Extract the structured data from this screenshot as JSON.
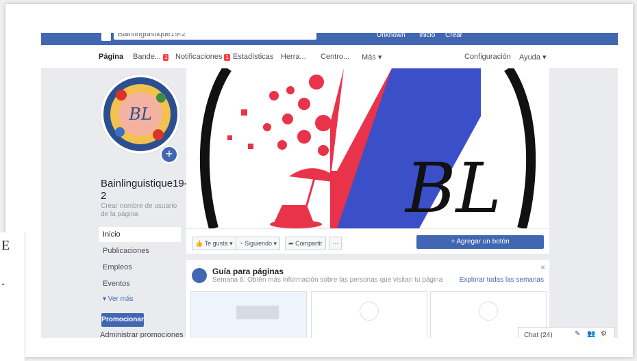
{
  "left_overlay": {
    "chars": [
      "E",
      "."
    ]
  },
  "topbar": {
    "search_value": "Bainlinguistique19-2",
    "user_name": "Unknown",
    "inicio": "Inicio",
    "crear": "Crear"
  },
  "pagenav": {
    "pagina": "Página",
    "bandeja": "Bande...",
    "bandeja_count": "1",
    "notificaciones": "Notificaciones",
    "notificaciones_count": "1",
    "estadisticas": "Estadísticas",
    "herramientas": "Herra...",
    "centro": "Centro...",
    "mas": "Más ▾",
    "configuracion": "Configuración",
    "ayuda": "Ayuda ▾"
  },
  "profile": {
    "avatar_text": "BL",
    "page_name": "Bainlinguistique19-2",
    "username_link": "Crear nombre de usuario de la página"
  },
  "sidebar": {
    "items": [
      "Inicio",
      "Publicaciones",
      "Empleos",
      "Eventos"
    ],
    "see_more": "▾ Ver más",
    "promote": "Promocionar",
    "manage_promos": "Administrar promociones"
  },
  "cover": {
    "logo_text": "BL"
  },
  "actions": {
    "like": "Te gusta ▾",
    "following": "Siguiendo ▾",
    "share": "Compartir",
    "more": "···",
    "add_button": "+ Agregar un botón"
  },
  "guide": {
    "title": "Guía para páginas",
    "subtitle": "Semana 6: Obtén más información sobre las personas que visitan tu página",
    "explore": "Explorar todas las semanas",
    "close": "×"
  },
  "chat": {
    "label": "Chat (24)"
  },
  "colors": {
    "fb_blue": "#4267b2",
    "badge_red": "#fa3e3e",
    "cover_red": "#e8334a",
    "cover_blue": "#3a4fc8"
  }
}
